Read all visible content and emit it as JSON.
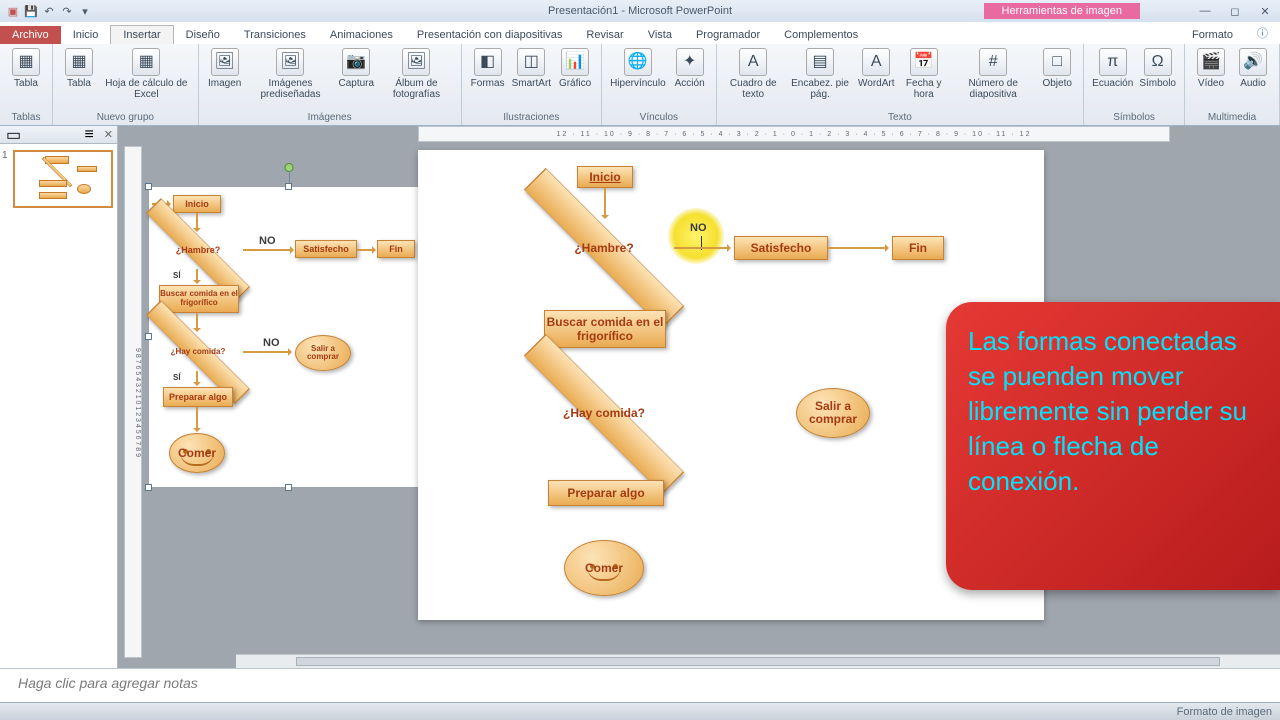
{
  "titlebar": {
    "title": "Presentación1 - Microsoft PowerPoint",
    "context_tab": "Herramientas de imagen"
  },
  "tabs": {
    "file": "Archivo",
    "items": [
      "Inicio",
      "Insertar",
      "Diseño",
      "Transiciones",
      "Animaciones",
      "Presentación con diapositivas",
      "Revisar",
      "Vista",
      "Programador",
      "Complementos"
    ],
    "context": "Formato",
    "active_index": 1
  },
  "ribbon": {
    "groups": [
      {
        "label": "Tablas",
        "buttons": [
          {
            "l": "Tabla",
            "i": "▦"
          }
        ]
      },
      {
        "label": "Nuevo grupo",
        "buttons": [
          {
            "l": "Tabla",
            "i": "▦"
          },
          {
            "l": "Hoja de cálculo de Excel",
            "i": "▦"
          }
        ]
      },
      {
        "label": "Imágenes",
        "buttons": [
          {
            "l": "Imagen",
            "i": "🖼"
          },
          {
            "l": "Imágenes prediseñadas",
            "i": "🖼"
          },
          {
            "l": "Captura",
            "i": "📷"
          },
          {
            "l": "Álbum de fotografías",
            "i": "🖼"
          }
        ]
      },
      {
        "label": "Ilustraciones",
        "buttons": [
          {
            "l": "Formas",
            "i": "◧"
          },
          {
            "l": "SmartArt",
            "i": "◫"
          },
          {
            "l": "Gráfico",
            "i": "📊"
          }
        ]
      },
      {
        "label": "Vínculos",
        "buttons": [
          {
            "l": "Hipervínculo",
            "i": "🌐"
          },
          {
            "l": "Acción",
            "i": "✦"
          }
        ]
      },
      {
        "label": "Texto",
        "buttons": [
          {
            "l": "Cuadro de texto",
            "i": "A"
          },
          {
            "l": "Encabez. pie pág.",
            "i": "▤"
          },
          {
            "l": "WordArt",
            "i": "A"
          },
          {
            "l": "Fecha y hora",
            "i": "📅"
          },
          {
            "l": "Número de diapositiva",
            "i": "#"
          },
          {
            "l": "Objeto",
            "i": "□"
          }
        ]
      },
      {
        "label": "Símbolos",
        "buttons": [
          {
            "l": "Ecuación",
            "i": "π"
          },
          {
            "l": "Símbolo",
            "i": "Ω"
          }
        ]
      },
      {
        "label": "Multimedia",
        "buttons": [
          {
            "l": "Vídeo",
            "i": "🎬"
          },
          {
            "l": "Audio",
            "i": "🔊"
          }
        ]
      }
    ]
  },
  "ruler_marks": "12 · 11 · 10 · 9 · 8 · 7 · 6 · 5 · 4 · 3 · 2 · 1 · 0 · 1 · 2 · 3 · 4 · 5 · 6 · 7 · 8 · 9 · 10 · 11 · 12",
  "flow": {
    "inicio": "Inicio",
    "hambre": "¿Hambre?",
    "no": "NO",
    "si": "SÍ",
    "satisfecho": "Satisfecho",
    "fin": "Fin",
    "buscar": "Buscar comida en el frigorífico",
    "hay": "¿Hay comida?",
    "salir": "Salir a comprar",
    "preparar": "Preparar algo",
    "comer": "Comer"
  },
  "callout": "Las formas conectadas se puenden mover libremente sin perder su línea o flecha de conexión.",
  "notes_placeholder": "Haga clic para agregar notas",
  "status": {
    "right": "Formato de imagen"
  },
  "slide_number": "1"
}
